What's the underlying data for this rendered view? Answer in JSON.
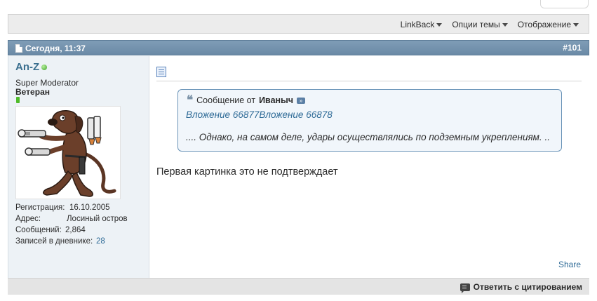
{
  "thread_options": {
    "linkback": "LinkBack",
    "thread_options": "Опции темы",
    "display": "Отображение"
  },
  "post": {
    "date": "Сегодня, 11:37",
    "number": "#101",
    "message": "Первая картинка это не подтверждает",
    "share": "Share",
    "reply_quote": "Ответить с цитированием"
  },
  "user": {
    "name": "An-Z",
    "title": "Super Moderator",
    "rank": "Ветеран",
    "stats": [
      {
        "label": "Регистрация:",
        "value": "16.10.2005"
      },
      {
        "label": "Адрес:",
        "value": "Лосиный остров"
      },
      {
        "label": "Сообщений:",
        "value": "2,864"
      },
      {
        "label": "Записей в дневнике:",
        "value": "28"
      }
    ]
  },
  "quote": {
    "prefix": "Сообщение от",
    "author": "Иваныч",
    "attachment_1": "Вложение 66877",
    "attachment_2": "Вложение 66878",
    "text": ".... Однако, на самом деле, удары осуществлялись по подземным укреплениям. .."
  },
  "colors": {
    "header_blue": "#7592ad",
    "link_blue": "#2f6b97",
    "online_green": "#3fa42c"
  }
}
